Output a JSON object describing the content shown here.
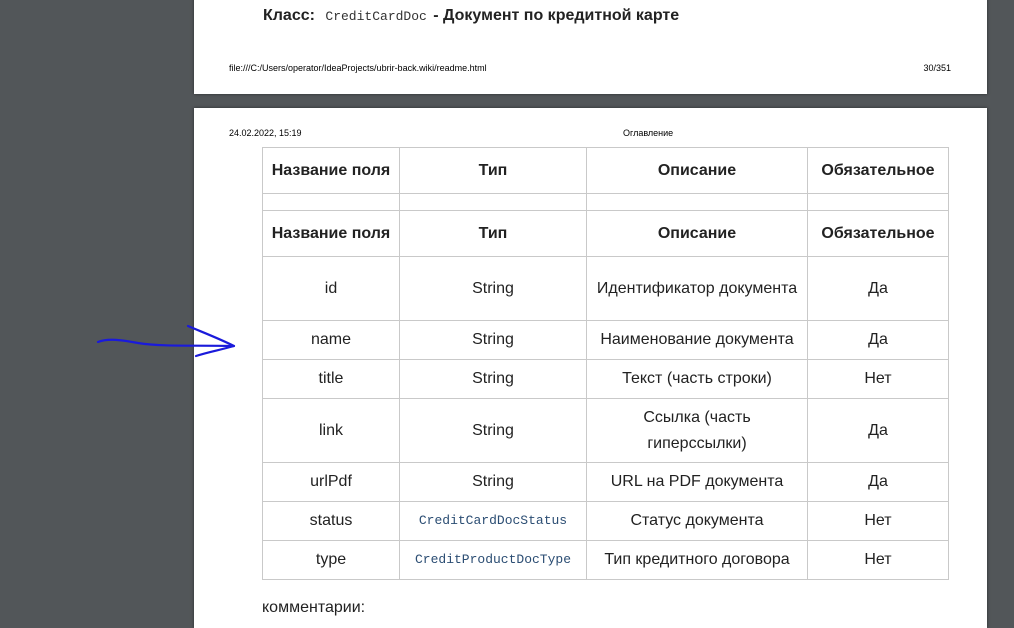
{
  "page_prev": {
    "heading_prefix": "Класс:",
    "heading_code": "CreditCardDoc",
    "heading_suffix": "- Документ по кредитной карте",
    "footer_url": "file:///C:/Users/operator/IdeaProjects/ubrir-back.wiki/readme.html",
    "footer_page": "30/351"
  },
  "page_current": {
    "header_date": "24.02.2022, 15:19",
    "header_title": "Оглавление",
    "comments_label": "комментарии:"
  },
  "table": {
    "headers": [
      "Название поля",
      "Тип",
      "Описание",
      "Обязательное"
    ],
    "rows": [
      {
        "field": "id",
        "type": "String",
        "description": "Идентификатор документа",
        "required": "Да"
      },
      {
        "field": "name",
        "type": "String",
        "description": "Наименование документа",
        "required": "Да"
      },
      {
        "field": "title",
        "type": "String",
        "description": "Текст (часть строки)",
        "required": "Нет"
      },
      {
        "field": "link",
        "type": "String",
        "description": "Ссылка (часть гиперссылки)",
        "required": "Да"
      },
      {
        "field": "urlPdf",
        "type": "String",
        "description": "URL на PDF документа",
        "required": "Да"
      },
      {
        "field": "status",
        "type": "CreditCardDocStatus",
        "description": "Статус документа",
        "required": "Нет"
      },
      {
        "field": "type",
        "type": "CreditProductDocType",
        "description": "Тип кредитного договора",
        "required": "Нет"
      }
    ]
  },
  "annotation": {
    "icon": "hand-drawn-arrow-icon",
    "color": "#1a1adb"
  }
}
